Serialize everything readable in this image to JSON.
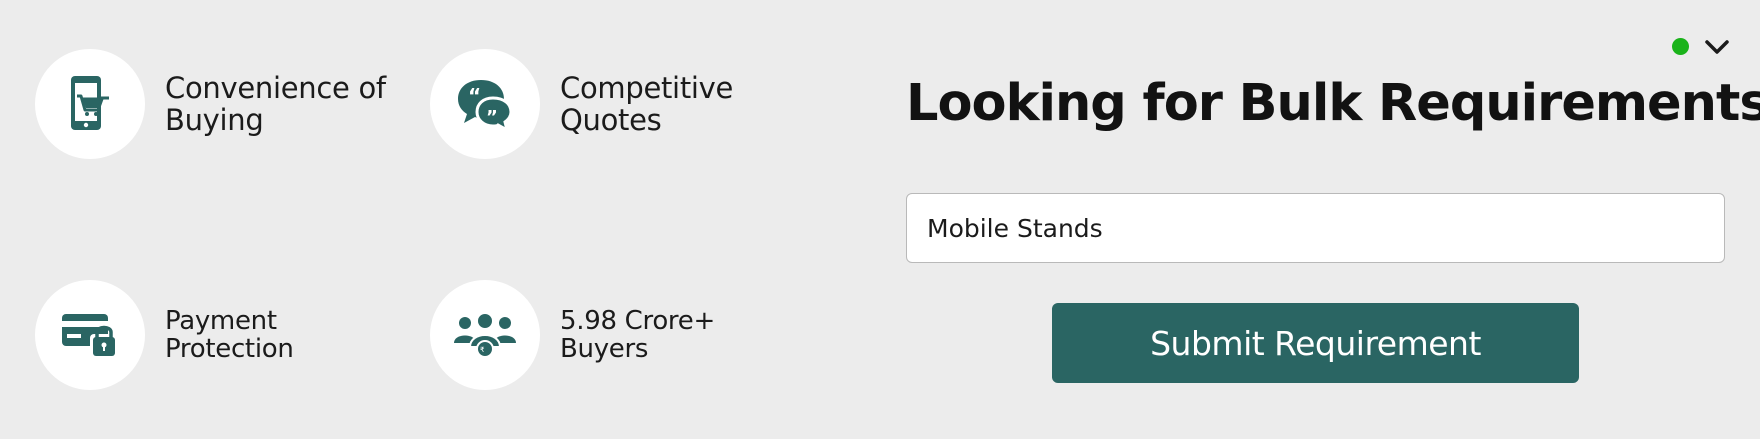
{
  "features": [
    {
      "label": "Convenience of\nBuying",
      "icon": "mobile-cart-icon"
    },
    {
      "label": "Competitive\nQuotes",
      "icon": "quote-bubbles-icon"
    },
    {
      "label": "Payment\nProtection",
      "icon": "card-lock-icon"
    },
    {
      "label": "5.98 Crore+\nBuyers",
      "icon": "buyers-group-icon"
    }
  ],
  "panel": {
    "headline": "Looking for Bulk Requirements?",
    "product_value": "Mobile Stands",
    "submit_label": "Submit Requirement"
  },
  "colors": {
    "background": "#ececec",
    "accent": "#2a6563",
    "icon": "#2a6563",
    "status_online": "#1ab31a"
  }
}
